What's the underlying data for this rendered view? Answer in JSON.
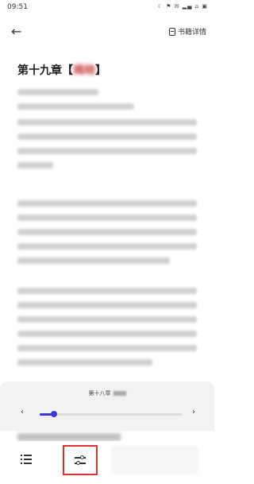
{
  "status_bar": {
    "time": "09:51",
    "icons": "☾ ⚑ ✉ ▂▄ ⌂ ▣"
  },
  "topbar": {
    "details_label": "书籍详情"
  },
  "chapter": {
    "title": "第十九章【",
    "title_blurred": "揭晓",
    "title_close": "】"
  },
  "progress_panel": {
    "chapter_label": "第十八章",
    "prev": "‹",
    "next": "›",
    "progress": 0.1
  },
  "accent_color": "#3a3ad0",
  "highlight_color": "#e03030",
  "icons": [
    "back-arrow-icon",
    "book-icon",
    "list-icon",
    "sliders-icon"
  ]
}
